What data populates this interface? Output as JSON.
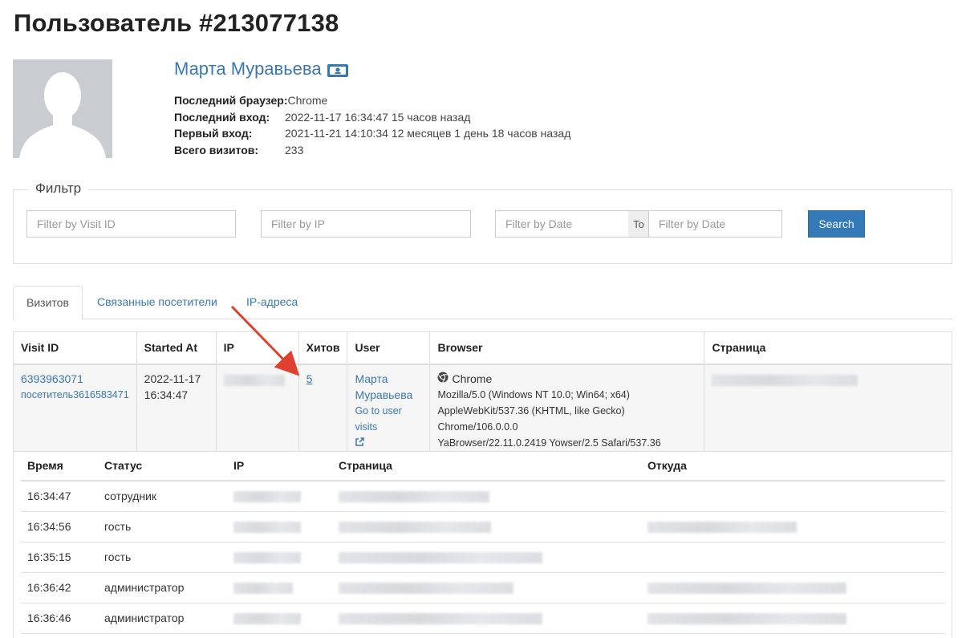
{
  "title": "Пользователь #213077138",
  "user": {
    "name": "Марта Муравьева",
    "info": [
      {
        "label": "Последний браузер:",
        "value": "Chrome"
      },
      {
        "label": "Последний вход:",
        "value": "2022-11-17 16:34:47 15 часов назад"
      },
      {
        "label": "Первый вход:",
        "value": "2021-11-21 14:10:34 12 месяцев 1 день 18 часов назад"
      },
      {
        "label": "Всего визитов:",
        "value": "233"
      }
    ]
  },
  "filter": {
    "legend": "Фильтр",
    "visit_id_placeholder": "Filter by Visit ID",
    "ip_placeholder": "Filter by IP",
    "date_from_placeholder": "Filter by Date",
    "to_label": "To",
    "date_to_placeholder": "Filter by Date",
    "search_label": "Search"
  },
  "tabs": [
    {
      "label": "Визитов",
      "active": true
    },
    {
      "label": "Связанные посетители",
      "active": false
    },
    {
      "label": "IP-адреса",
      "active": false
    }
  ],
  "visits_table": {
    "headers": [
      "Visit ID",
      "Started At",
      "IP",
      "Хитов",
      "User",
      "Browser",
      "Страница"
    ],
    "row": {
      "visit_id": "6393963071",
      "visitor": "посетитель3616583471",
      "started_date": "2022-11-17",
      "started_time": "16:34:47",
      "hits": "5",
      "user_first": "Марта",
      "user_last": "Муравьева",
      "user_visits_link": "Go to user visits",
      "browser_name": "Chrome",
      "ua_1": "Mozilla/5.0 (Windows NT 10.0; Win64; x64)",
      "ua_2": "AppleWebKit/537.36 (KHTML, like Gecko) Chrome/106.0.0.0",
      "ua_3": "YaBrowser/22.11.0.2419 Yowser/2.5 Safari/537.36"
    }
  },
  "hits_table": {
    "headers": [
      "Время",
      "Статус",
      "IP",
      "Страница",
      "Откуда"
    ],
    "rows": [
      {
        "time": "16:34:47",
        "status": "сотрудник"
      },
      {
        "time": "16:34:56",
        "status": "гость"
      },
      {
        "time": "16:35:15",
        "status": "гость"
      },
      {
        "time": "16:36:42",
        "status": "администратор"
      },
      {
        "time": "16:36:46",
        "status": "администратор"
      }
    ]
  },
  "colors": {
    "link": "#3a78b0",
    "button": "#337ab7",
    "arrow": "#e0402f"
  }
}
